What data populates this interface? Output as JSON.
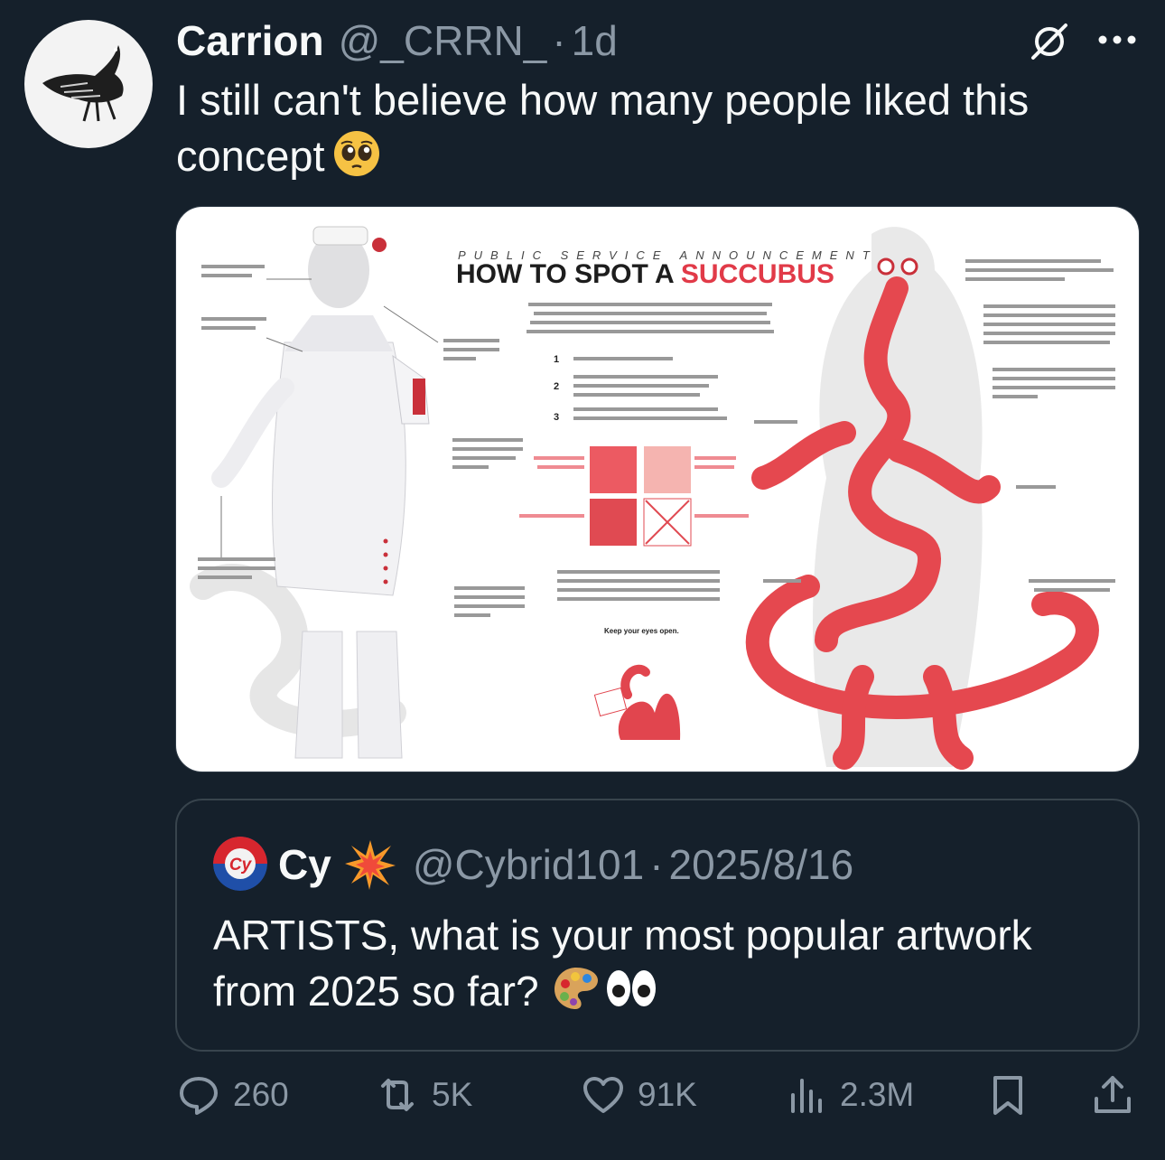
{
  "post": {
    "author_name": "Carrion",
    "handle": "@_CRRN_",
    "separator": "·",
    "time": "1d",
    "text": "I still can't believe how many people liked this concept",
    "emoji": "pleading-face"
  },
  "media": {
    "kicker": "PUBLIC SERVICE ANNOUNCEMENT",
    "title_prefix": "HOW TO SPOT A",
    "title_highlight": "SUCCUBUS",
    "closing": "Keep your eyes open."
  },
  "quote": {
    "author_name": "Cy",
    "name_emoji": "collision",
    "handle": "@Cybrid101",
    "separator": "·",
    "date": "2025/8/16",
    "text": "ARTISTS, what is your most popular artwork from 2025 so far?",
    "emojis": [
      "artist-palette",
      "eyes"
    ]
  },
  "actions": {
    "replies": "260",
    "reposts": "5K",
    "likes": "91K",
    "views": "2.3M"
  },
  "colors": {
    "background": "#15202b",
    "text": "#f7f9f9",
    "muted": "#8b98a5",
    "border": "#38444d",
    "accent_red": "#e13a48"
  }
}
